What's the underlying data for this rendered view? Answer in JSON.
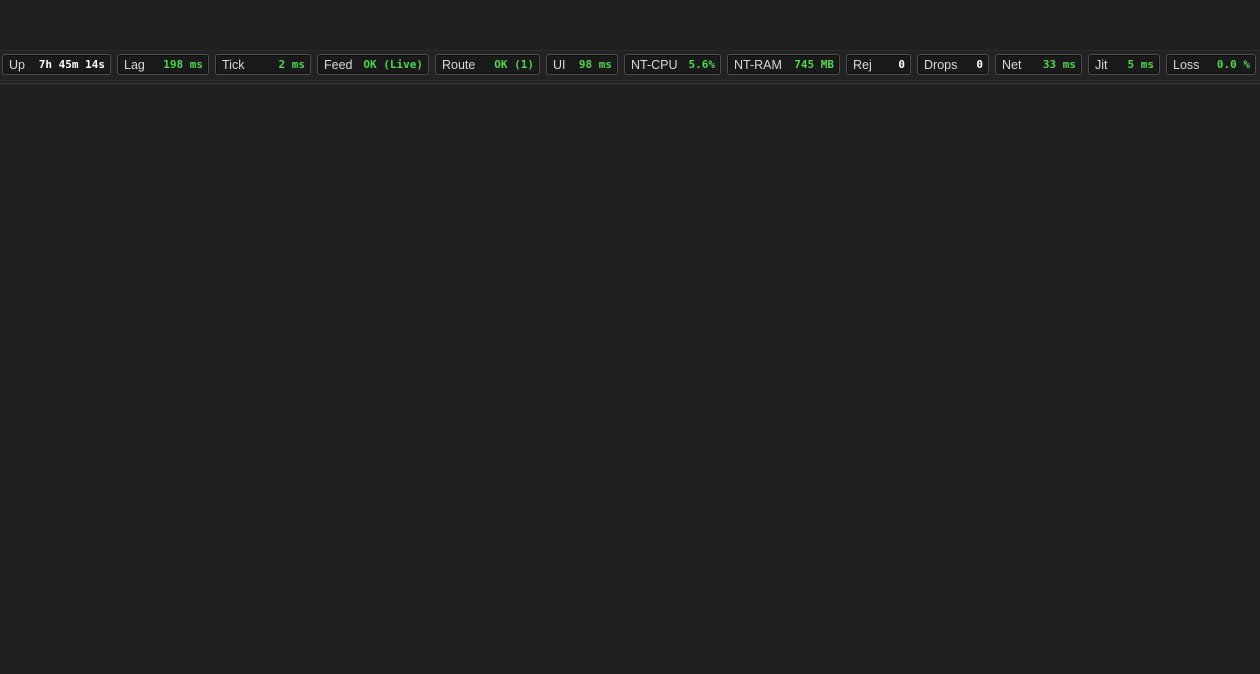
{
  "status_bar": {
    "metrics": [
      {
        "label": "Up",
        "value": "7h 45m 14s",
        "value_color": "#ffffff"
      },
      {
        "label": "Lag",
        "value": "198 ms",
        "value_color": "#4fd64f"
      },
      {
        "label": "Tick",
        "value": "2 ms",
        "value_color": "#4fd64f"
      },
      {
        "label": "Feed",
        "value": "OK (Live)",
        "value_color": "#4fd64f"
      },
      {
        "label": "Route",
        "value": "OK (1)",
        "value_color": "#4fd64f"
      },
      {
        "label": "UI",
        "value": "98 ms",
        "value_color": "#4fd64f"
      },
      {
        "label": "NT-CPU",
        "value": "5.6%",
        "value_color": "#4fd64f"
      },
      {
        "label": "NT-RAM",
        "value": "745 MB",
        "value_color": "#4fd64f"
      },
      {
        "label": "Rej",
        "value": "0",
        "value_color": "#ffffff"
      },
      {
        "label": "Drops",
        "value": "0",
        "value_color": "#ffffff"
      },
      {
        "label": "Net",
        "value": "33 ms",
        "value_color": "#4fd64f"
      },
      {
        "label": "Jit",
        "value": "5 ms",
        "value_color": "#4fd64f"
      },
      {
        "label": "Loss",
        "value": "0.0 %",
        "value_color": "#4fd64f"
      }
    ]
  },
  "colors": {
    "background": "#202020",
    "ok_green": "#4fd64f",
    "neutral_white": "#ffffff",
    "label_gray": "#d8d8d8"
  }
}
